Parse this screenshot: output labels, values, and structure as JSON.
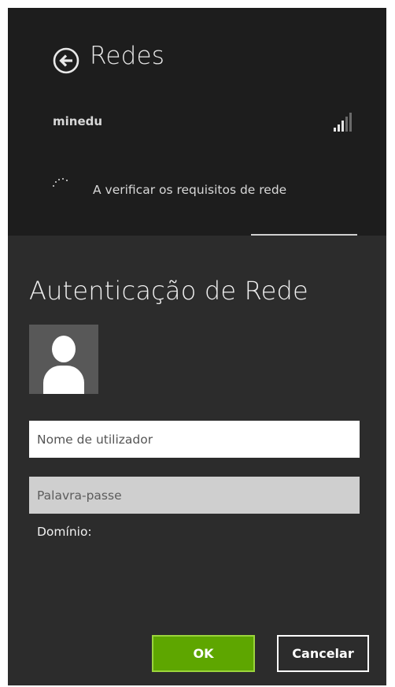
{
  "networks_panel": {
    "title": "Redes",
    "network_name": "minedu",
    "status_text": "A verificar os requisitos de rede",
    "back_icon": "arrow-left-circle-icon",
    "signal_icon": "signal-strength-icon",
    "spinner_icon": "loading-dots-icon"
  },
  "auth_dialog": {
    "title": "Autenticação de Rede",
    "avatar_icon": "user-avatar-icon",
    "username_placeholder": "Nome de utilizador",
    "username_value": "",
    "password_placeholder": "Palavra-passe",
    "password_value": "",
    "domain_label": "Domínio:",
    "ok_label": "OK",
    "cancel_label": "Cancelar"
  },
  "colors": {
    "top_background": "#1d1d1d",
    "dialog_background": "#2c2c2c",
    "accent_green": "#5ea600",
    "accent_green_border": "#9bd43c",
    "signal_active": "#e6e6e6",
    "signal_inactive": "#6a6a6a"
  }
}
